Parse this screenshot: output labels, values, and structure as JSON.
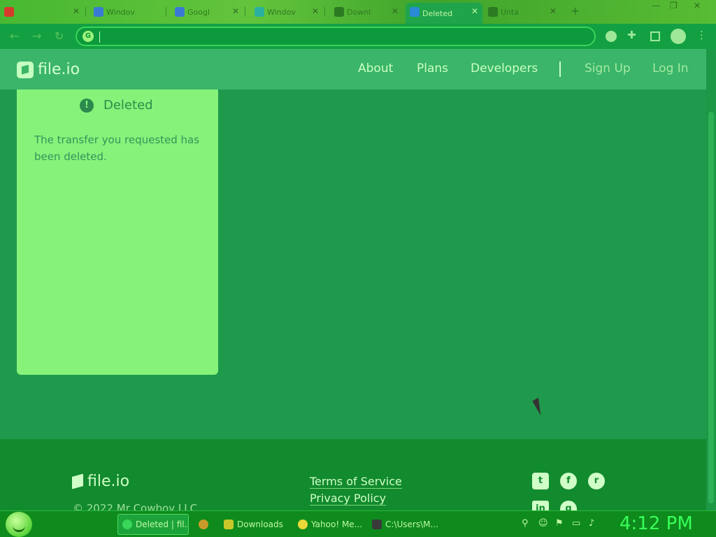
{
  "browser": {
    "tabs": [
      {
        "label": "",
        "favicon_color": "#d63a2a"
      },
      {
        "label": "Windov",
        "favicon_color": "#3a7ad6"
      },
      {
        "label": "Googl",
        "favicon_color": "#3a7ad6"
      },
      {
        "label": "Windov",
        "favicon_color": "#2ab0a0"
      },
      {
        "label": "Downl",
        "favicon_color": "#2c7a22"
      },
      {
        "label": "Deleted",
        "favicon_color": "#2a8ad6",
        "active": true
      },
      {
        "label": "Unta",
        "favicon_color": "#2c7a22"
      }
    ],
    "new_tab": "+",
    "address": ""
  },
  "site": {
    "logo_text": "file.io",
    "nav": {
      "about": "About",
      "plans": "Plans",
      "developers": "Developers",
      "signup": "Sign Up",
      "login": "Log In"
    },
    "card": {
      "icon": "!",
      "title": "Deleted",
      "message": "The transfer you requested has been deleted."
    },
    "footer": {
      "logo_text": "file.io",
      "copyright": "© 2022 Mr Cowboy LLC",
      "links": [
        "Terms of Service",
        "Privacy Policy"
      ],
      "social": [
        "twitter-icon",
        "facebook-icon",
        "reddit-icon",
        "linkedin-icon",
        "github-icon"
      ]
    }
  },
  "taskbar": {
    "items": [
      {
        "label": "Deleted | fil...",
        "active": true,
        "icon_color": "#3ad65a"
      },
      {
        "label": "",
        "icon_color": "#c89a2a"
      },
      {
        "label": "Downloads",
        "icon_color": "#c8c82a"
      },
      {
        "label": "Yahoo! Me...",
        "icon_color": "#e8d83a"
      },
      {
        "label": "C:\\Users\\M...",
        "icon_color": "#3a3a3a"
      }
    ],
    "clock": "4:12 PM"
  },
  "colors": {
    "accent": "#86f27a",
    "background": "#1f9a4c",
    "header": "#3ab56a",
    "footer": "#128a2e"
  }
}
